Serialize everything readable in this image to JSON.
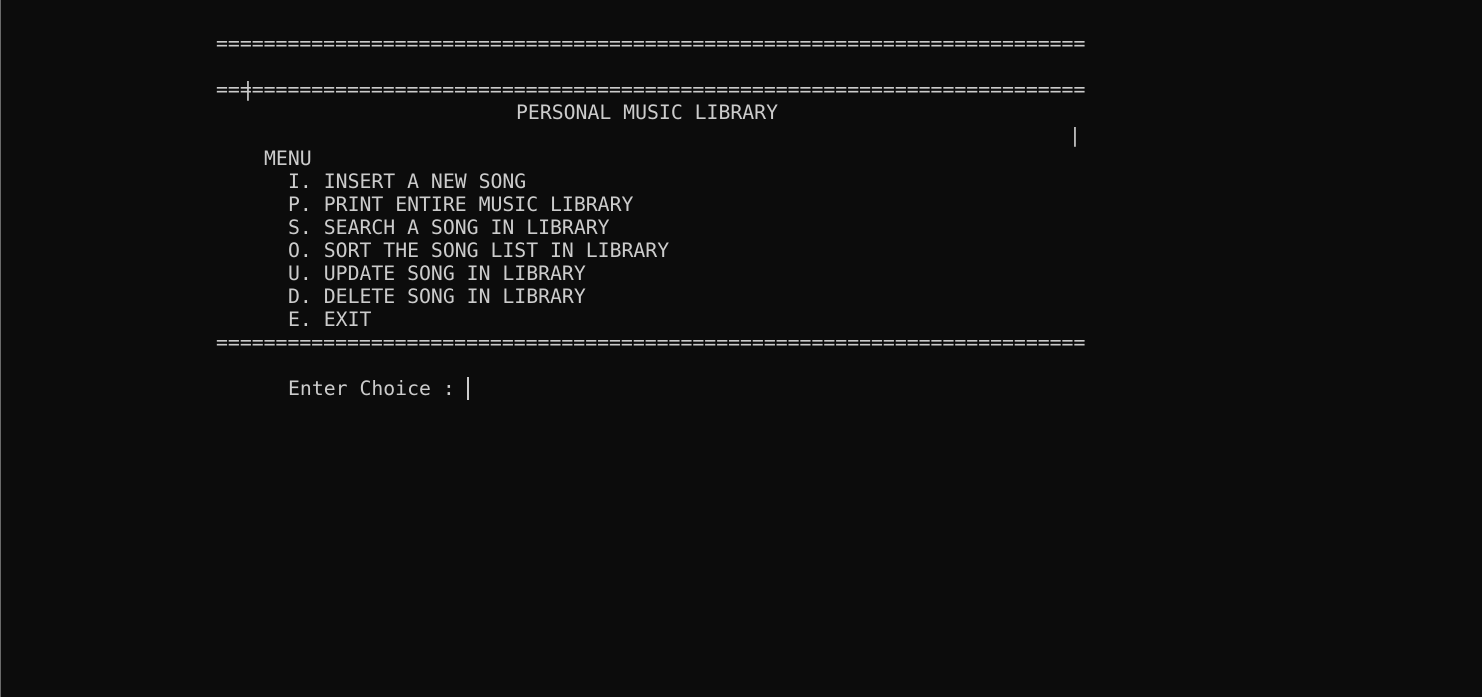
{
  "header": {
    "rule": "=========================================================================",
    "left_pipe": "|",
    "right_pipe": "|",
    "title": "PERSONAL MUSIC LIBRARY"
  },
  "menu": {
    "heading": "MENU",
    "items": [
      {
        "key": "I.",
        "label": "INSERT A NEW SONG"
      },
      {
        "key": "P.",
        "label": "PRINT ENTIRE MUSIC LIBRARY"
      },
      {
        "key": "S.",
        "label": "SEARCH A SONG IN LIBRARY"
      },
      {
        "key": "O.",
        "label": "SORT THE SONG LIST IN LIBRARY"
      },
      {
        "key": "U.",
        "label": "UPDATE SONG IN LIBRARY"
      },
      {
        "key": "D.",
        "label": "DELETE SONG IN LIBRARY"
      },
      {
        "key": "E.",
        "label": "EXIT"
      }
    ]
  },
  "prompt": {
    "label": "Enter Choice :",
    "value": ""
  },
  "colors": {
    "background": "#0c0c0c",
    "text": "#cccccc"
  }
}
